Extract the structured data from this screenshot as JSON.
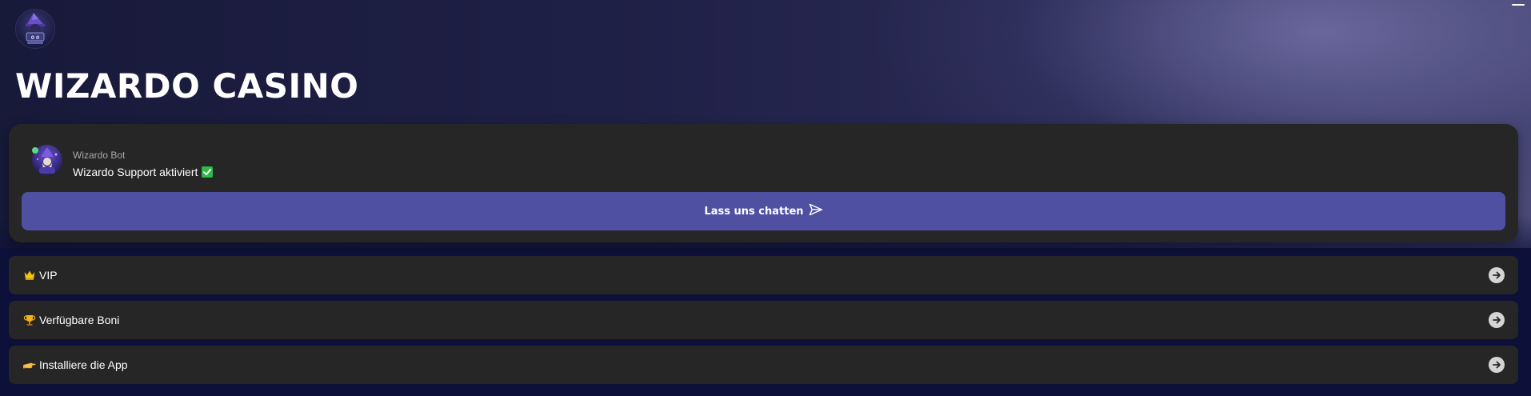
{
  "header": {
    "logo_icon": "wizard-logo-icon",
    "menu_icon": "menu-dash-icon",
    "title": "WIZARDO CASINO"
  },
  "chat_card": {
    "bot_name": "Wizardo Bot",
    "message": "Wizardo Support aktiviert",
    "message_icon": "check-mark-icon",
    "status_color": "#5cd68a",
    "button_label": "Lass uns chatten",
    "button_icon": "send-icon",
    "button_color": "#5050a2"
  },
  "menu": {
    "items": [
      {
        "icon": "crown-icon",
        "label": "VIP"
      },
      {
        "icon": "trophy-icon",
        "label": "Verfügbare Boni"
      },
      {
        "icon": "pointing-hand-icon",
        "label": "Installiere die App"
      }
    ],
    "arrow_icon": "arrow-right-circle-icon"
  },
  "colors": {
    "background": "#0d1038",
    "card": "#262626",
    "accent": "#5050a2"
  }
}
